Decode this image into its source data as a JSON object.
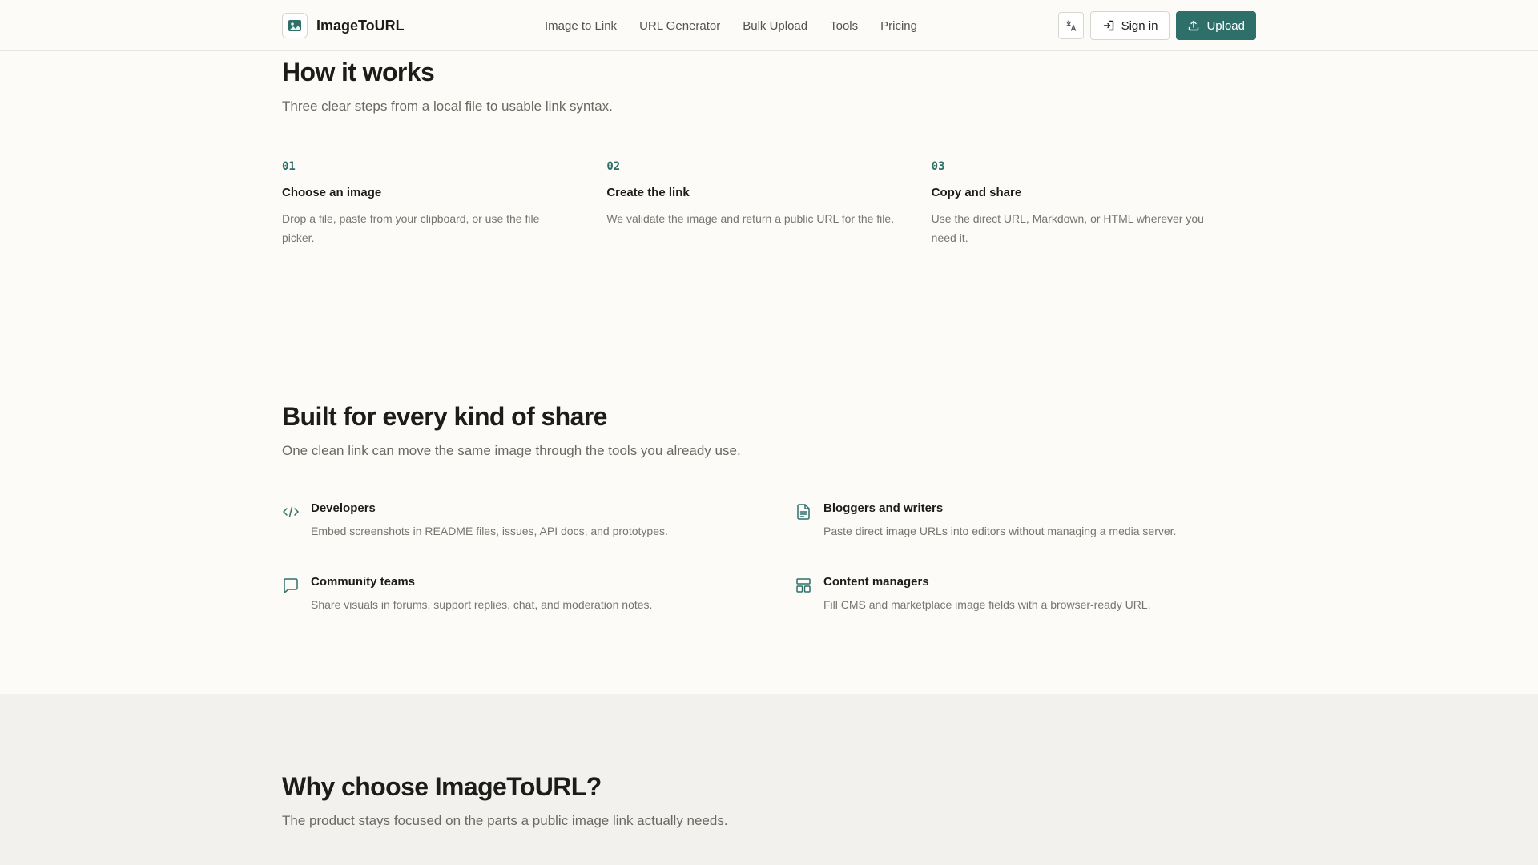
{
  "header": {
    "brand": "ImageToURL",
    "nav": [
      "Image to Link",
      "URL Generator",
      "Bulk Upload",
      "Tools",
      "Pricing"
    ],
    "signin_label": "Sign in",
    "upload_label": "Upload"
  },
  "how": {
    "title": "How it works",
    "subtitle": "Three clear steps from a local file to usable link syntax.",
    "steps": [
      {
        "num": "01",
        "title": "Choose an image",
        "desc": "Drop a file, paste from your clipboard, or use the file picker."
      },
      {
        "num": "02",
        "title": "Create the link",
        "desc": "We validate the image and return a public URL for the file."
      },
      {
        "num": "03",
        "title": "Copy and share",
        "desc": "Use the direct URL, Markdown, or HTML wherever you need it."
      }
    ]
  },
  "built": {
    "title": "Built for every kind of share",
    "subtitle": "One clean link can move the same image through the tools you already use.",
    "audiences": [
      {
        "icon": "code-icon",
        "title": "Developers",
        "desc": "Embed screenshots in README files, issues, API docs, and prototypes."
      },
      {
        "icon": "document-icon",
        "title": "Bloggers and writers",
        "desc": "Paste direct image URLs into editors without managing a media server."
      },
      {
        "icon": "chat-icon",
        "title": "Community teams",
        "desc": "Share visuals in forums, support replies, chat, and moderation notes."
      },
      {
        "icon": "layout-icon",
        "title": "Content managers",
        "desc": "Fill CMS and marketplace image fields with a browser-ready URL."
      }
    ]
  },
  "why": {
    "title": "Why choose ImageToURL?",
    "subtitle": "The product stays focused on the parts a public image link actually needs."
  },
  "colors": {
    "accent": "#2f6f6a",
    "background": "#fcfbf8",
    "muted_bg": "#f2f1ee"
  }
}
